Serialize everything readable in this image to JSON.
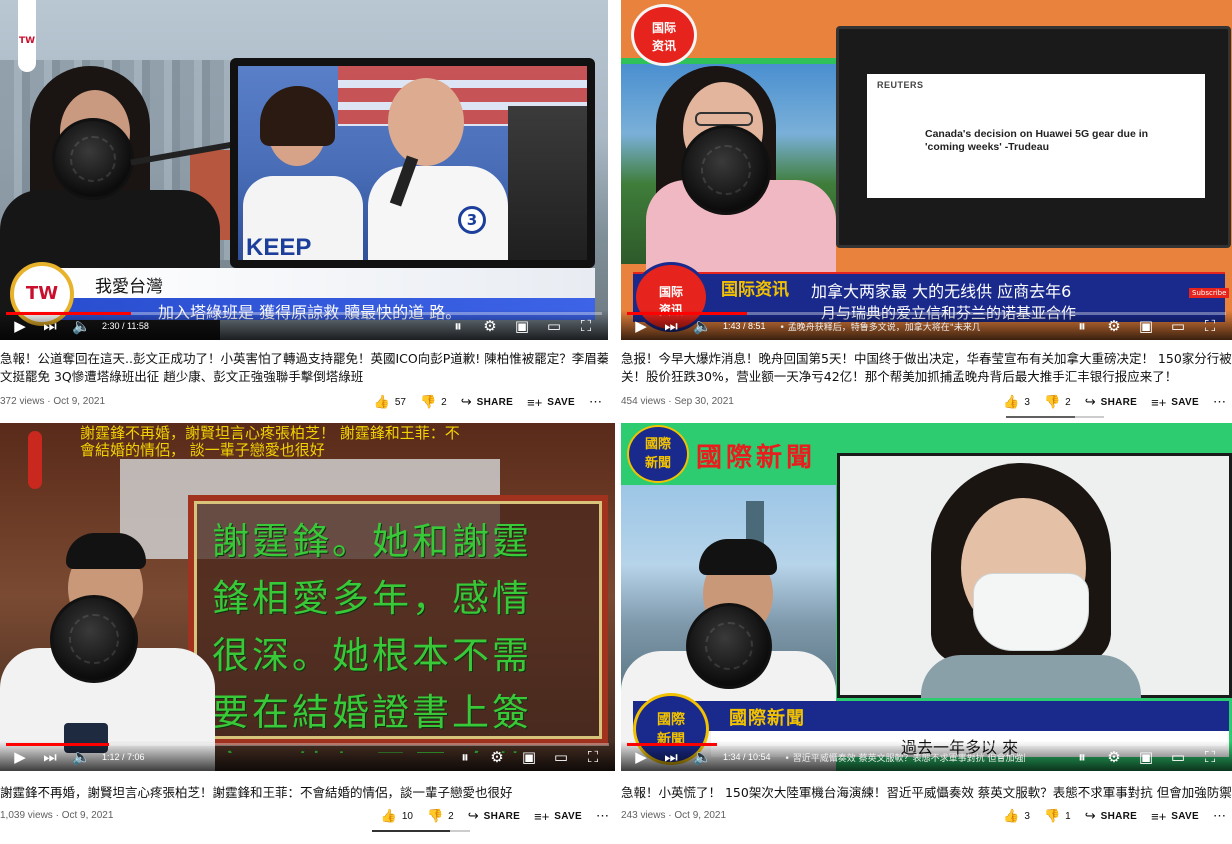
{
  "videos": [
    {
      "banner_name": "我愛台灣",
      "subtitle": "加入塔綠班是 獲得原諒救 贖最快的道 路。",
      "logo_top": "TW",
      "logo_badge": "TW",
      "time": "2:30 / 11:58",
      "progress": 0.21,
      "title_line1": "急報！公道奪回在這天..彭文正成功了！小英害怕了轉過支持罷免！英國ICO向彭P道歉! 陳柏惟被罷定？李眉蓁PO",
      "title_line2": "文挺罷免 3Q慘遭塔綠班出征 趙少康、彭文正強強聯手擊倒塔綠班",
      "stats": "372 views · Oct 9, 2021",
      "likes": "57",
      "dislikes": "2",
      "share": "SHARE",
      "save": "SAVE",
      "rally_text": "KEEP",
      "number_badge": "3"
    },
    {
      "corner_badge_line1": "国际",
      "corner_badge_line2": "资讯",
      "screen_brand": "REUTERS",
      "screen_headline": "Canada's decision on Huawei 5G gear due in 'coming weeks' -Trudeau",
      "banner_channel": "国际资讯",
      "banner_line1": "加拿大两家最 大的无线供 应商去年6",
      "banner_line2": "月与瑞典的爱立信和芬兰的诺基亚合作",
      "badge_line1": "国际",
      "badge_line2": "资讯",
      "time": "1:43 / 8:51",
      "chapter": "• 孟晚舟获释后，特鲁多文说，加拿大将在\"未来几周\"决定是否禁止...",
      "progress": 0.2,
      "title_line1": "急报！今早大爆炸消息！晚舟回国第5天！中国终于做出决定，华春莹宣布有关加拿大重磅决定！ 150家分行被",
      "title_line2": "关！股价狂跌30%，营业额一天净亏42亿！那个帮美加抓捕孟晚舟背后最大推手汇丰银行报应来了！",
      "stats": "454 views · Sep 30, 2021",
      "likes": "3",
      "dislikes": "2",
      "share": "SHARE",
      "save": "SAVE",
      "subscribe": "Subscribe"
    },
    {
      "overlay_top": "謝霆鋒不再婚，謝賢坦言心疼張柏芝！ 謝霆鋒和王菲：不會結婚的情侶， 談一輩子戀愛也很好",
      "overlay_main": "謝霆鋒。她和謝霆 鋒相愛多年，感情 很深。她根本不需 要在結婚證書上簽 字。他們是靈魂伴",
      "time": "1:12 / 7:06",
      "progress": 0.17,
      "title_line1": "謝霆鋒不再婚，謝賢坦言心疼張柏芝！謝霆鋒和王菲：不會結婚的情侶，談一輩子戀愛也很好",
      "stats": "1,039 views · Oct 9, 2021",
      "likes": "10",
      "dislikes": "2",
      "share": "SHARE",
      "save": "SAVE"
    },
    {
      "seal_chars": "國際新聞",
      "header_title": "國際新聞",
      "badge_line1": "國際",
      "badge_line2": "新聞",
      "banner_title": "國際新聞",
      "subtitle": "過去一年多以 來",
      "time": "1:34 / 10:54",
      "chapter": "• 習近平威懾奏效 蔡英文服軟？表態不求軍事對抗 但會加強防禦 >",
      "progress": 0.15,
      "title_line1": "急報！小英慌了！ 150架次大陸軍機台海演練！習近平威懾奏效 蔡英文服軟？表態不求軍事對抗 但會加強防禦",
      "stats": "243 views · Oct 9, 2021",
      "likes": "3",
      "dislikes": "1",
      "share": "SHARE",
      "save": "SAVE"
    }
  ],
  "icons": {
    "play": "play-icon",
    "next": "next-icon",
    "volume": "volume-icon",
    "pause_toggle": "autoplay-toggle-icon",
    "settings": "gear-icon",
    "miniplayer": "miniplayer-icon",
    "theater": "theater-icon",
    "fullscreen": "fullscreen-icon",
    "like": "thumbs-up-icon",
    "dislike": "thumbs-down-icon",
    "share": "share-icon",
    "save": "save-playlist-icon",
    "more": "more-icon"
  },
  "colors": {
    "progress_red": "#ff0000",
    "banner_blue": "#1a2a8c",
    "green_screen": "#2ecc71",
    "orange_bg": "#e8823c",
    "gold_text": "#f2c200"
  }
}
